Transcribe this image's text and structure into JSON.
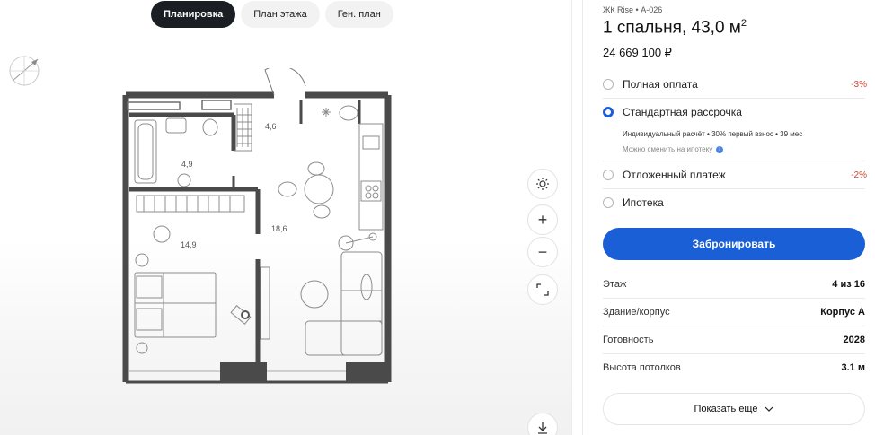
{
  "tabs": [
    {
      "label": "Планировка",
      "active": true
    },
    {
      "label": "План этажа",
      "active": false
    },
    {
      "label": "Ген. план",
      "active": false
    }
  ],
  "plan": {
    "rooms": [
      {
        "label": "4,6"
      },
      {
        "label": "4,9"
      },
      {
        "label": "14,9"
      },
      {
        "label": "18,6"
      }
    ]
  },
  "tools": {
    "brightness_icon": "sun-icon",
    "zoom_in": "+",
    "zoom_out": "−",
    "fullscreen_icon": "expand-icon",
    "download_icon": "download-icon"
  },
  "panel": {
    "crumb": "ЖК Rise • А-026",
    "title": "1 спальня, 43,0 м",
    "title_sup": "2",
    "price": "24 669 100 ₽",
    "options": [
      {
        "label": "Полная оплата",
        "discount": "-3%",
        "selected": false
      },
      {
        "label": "Стандартная рассрочка",
        "discount": "",
        "selected": true
      },
      {
        "label": "Отложенный платеж",
        "discount": "-2%",
        "selected": false
      },
      {
        "label": "Ипотека",
        "discount": "",
        "selected": false
      }
    ],
    "installment_details": "Индивидуальный расчёт • 30% первый взнос • 39 мес",
    "installment_note": "Можно сменить на ипотеку",
    "book_label": "Забронировать",
    "specs": [
      {
        "key": "Этаж",
        "value": "4 из 16"
      },
      {
        "key": "Здание/корпус",
        "value": "Корпус А"
      },
      {
        "key": "Готовность",
        "value": "2028"
      },
      {
        "key": "Высота потолков",
        "value": "3.1 м"
      }
    ],
    "more_label": "Показать еще"
  },
  "colors": {
    "accent": "#1a5fd6",
    "discount": "#d6432e",
    "active_tab": "#1b1e22",
    "wall": "#4a4a4a"
  }
}
